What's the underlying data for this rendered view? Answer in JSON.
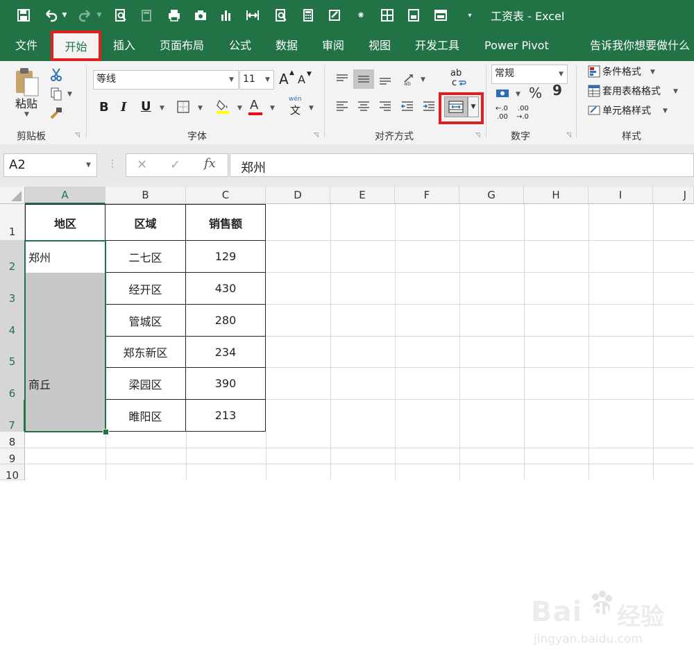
{
  "window": {
    "title": "工资表 - Excel"
  },
  "quick_access": {
    "icons": [
      "save-icon",
      "undo-icon",
      "redo-icon",
      "print-preview-icon",
      "calculator-disabled-icon",
      "print-icon",
      "camera-icon",
      "chart-icon",
      "column-width-icon",
      "find-icon",
      "calculator-icon",
      "form-icon",
      "spark-icon",
      "border-icon",
      "page-icon",
      "window-icon",
      "customize-icon"
    ]
  },
  "menu": {
    "items": [
      "文件",
      "开始",
      "插入",
      "页面布局",
      "公式",
      "数据",
      "审阅",
      "视图",
      "开发工具",
      "Power Pivot"
    ],
    "tell_me": "告诉我你想要做什么",
    "active": "开始"
  },
  "ribbon": {
    "clipboard": {
      "label": "剪贴板",
      "paste": "粘贴"
    },
    "font": {
      "label": "字体",
      "name": "等线",
      "size": "11",
      "bold": "B",
      "italic": "I",
      "underline": "U",
      "increase": "A",
      "decrease": "A",
      "wen": "wén",
      "wen_char": "文",
      "font_color_letter": "A"
    },
    "alignment": {
      "label": "对齐方式",
      "ab": "ab",
      "c": "c"
    },
    "number": {
      "label": "数字",
      "format": "常规",
      "percent": "%",
      "comma": "9",
      "inc_decimal_top": "←.0",
      "inc_decimal_bottom": ".00",
      "dec_decimal_top": ".00",
      "dec_decimal_bottom": "→.0"
    },
    "styles": {
      "label": "样式",
      "conditional": "条件格式",
      "table": "套用表格格式",
      "cell": "单元格样式"
    }
  },
  "formula_bar": {
    "name_box": "A2",
    "fx": "fx",
    "value": "郑州"
  },
  "sheet": {
    "columns": [
      "A",
      "B",
      "C",
      "D",
      "E",
      "F",
      "G",
      "H",
      "I",
      "J"
    ],
    "rows": [
      "1",
      "2",
      "3",
      "4",
      "5",
      "6",
      "7",
      "8",
      "9",
      "10"
    ],
    "headers": [
      "地区",
      "区域",
      "销售额"
    ],
    "col_a": [
      "郑州",
      "",
      "",
      "",
      "商丘",
      ""
    ],
    "col_b": [
      "二七区",
      "经开区",
      "管城区",
      "郑东新区",
      "梁园区",
      "睢阳区"
    ],
    "col_c": [
      "129",
      "430",
      "280",
      "234",
      "390",
      "213"
    ]
  },
  "watermark": {
    "brand": "Bai",
    "brand_tail": "du",
    "cn": "经验",
    "url": "jingyan.baidu.com"
  },
  "colors": {
    "excel_green": "#217346",
    "highlight_red": "#e02020",
    "selected_fill": "#c8c8c8"
  }
}
